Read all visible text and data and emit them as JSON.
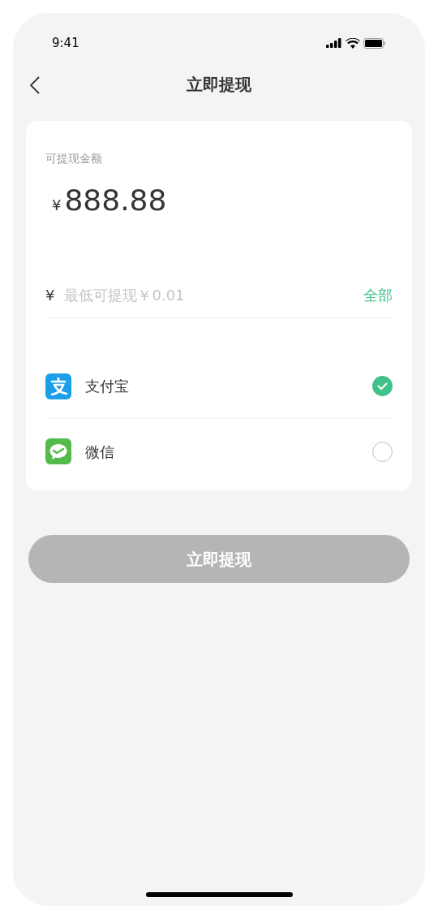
{
  "status_bar": {
    "time": "9:41"
  },
  "nav": {
    "title": "立即提现"
  },
  "balance": {
    "label": "可提现金额",
    "currency": "¥",
    "amount": "888.88"
  },
  "amount_input": {
    "prefix": "¥",
    "placeholder": "最低可提现￥0.01",
    "all_link": "全部"
  },
  "methods": [
    {
      "kind": "alipay",
      "label": "支付宝",
      "selected": true
    },
    {
      "kind": "wechat",
      "label": "微信",
      "selected": false
    }
  ],
  "submit": {
    "label": "立即提现",
    "disabled": true
  }
}
